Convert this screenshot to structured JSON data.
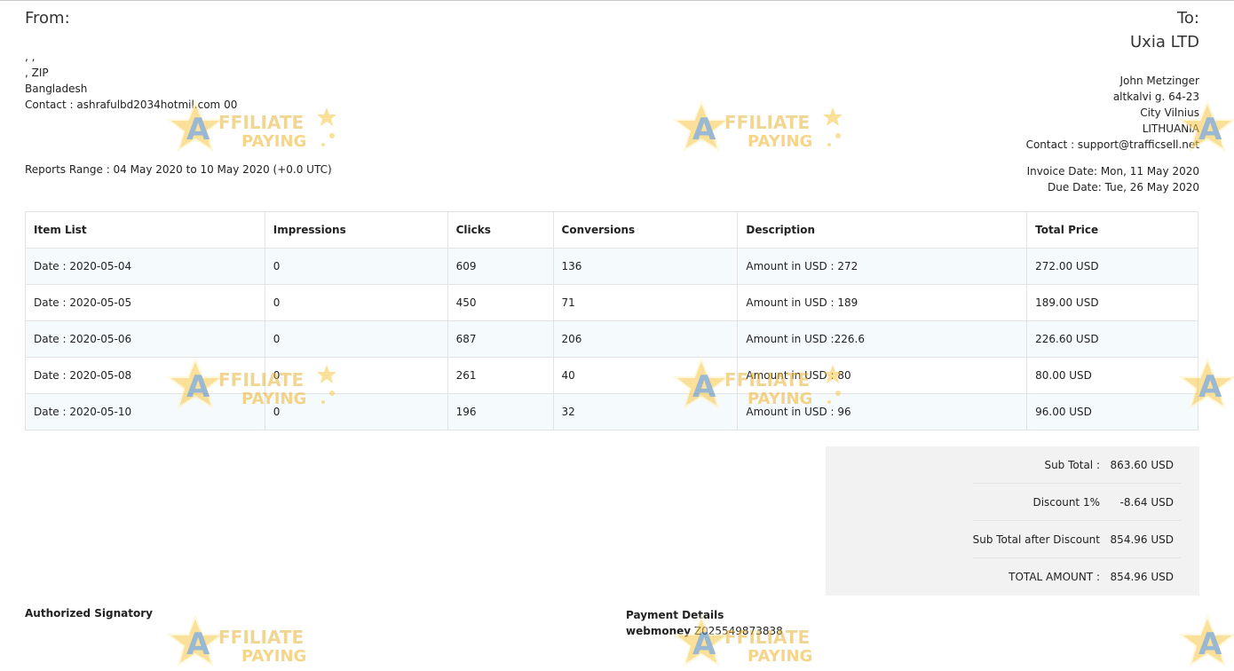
{
  "from": {
    "title": "From:",
    "lines": [
      ", ,",
      ", ZIP",
      "Bangladesh",
      "Contact : ashrafulbd2034hotmil.com 00"
    ]
  },
  "to": {
    "title": "To:",
    "company": "Uxia LTD",
    "lines": [
      "John Metzinger",
      "altkalvi g. 64-23",
      "City Vilnius",
      "LITHUANIA",
      "Contact : support@trafficsell.net"
    ]
  },
  "report_range": "Reports Range : 04 May 2020 to 10 May 2020 (+0.0 UTC)",
  "invoice_date": "Invoice Date: Mon, 11 May 2020",
  "due_date": "Due Date: Tue, 26 May 2020",
  "table": {
    "headers": [
      "Item List",
      "Impressions",
      "Clicks",
      "Conversions",
      "Description",
      "Total Price"
    ],
    "rows": [
      [
        "Date : 2020-05-04",
        "0",
        "609",
        "136",
        "Amount in USD : 272",
        "272.00 USD"
      ],
      [
        "Date : 2020-05-05",
        "0",
        "450",
        "71",
        "Amount in USD : 189",
        "189.00 USD"
      ],
      [
        "Date : 2020-05-06",
        "0",
        "687",
        "206",
        "Amount in USD :226.6",
        "226.60 USD"
      ],
      [
        "Date : 2020-05-08",
        "0",
        "261",
        "40",
        "Amount in USD : 80",
        "80.00 USD"
      ],
      [
        "Date : 2020-05-10",
        "0",
        "196",
        "32",
        "Amount in USD : 96",
        "96.00 USD"
      ]
    ]
  },
  "totals": {
    "sub_total_label": "Sub Total :",
    "sub_total_value": "863.60 USD",
    "discount_label": "Discount 1%",
    "discount_value": "-8.64 USD",
    "after_discount_label": "Sub Total after Discount",
    "after_discount_value": "854.96 USD",
    "total_label": "TOTAL AMOUNT :",
    "total_value": "854.96 USD"
  },
  "footer": {
    "signatory": "Authorized Signatory",
    "payment_title": "Payment Details",
    "payment_method": "webmoney",
    "payment_account": "Z025549873838"
  },
  "watermark": {
    "top": "FFILIATE",
    "bottom": "PAYING",
    "letter": "A",
    "colors": {
      "star": "#f6c744",
      "letter": "#4a7fb0",
      "text": "#e7b53c",
      "bottom_text": "#f0b429"
    }
  }
}
